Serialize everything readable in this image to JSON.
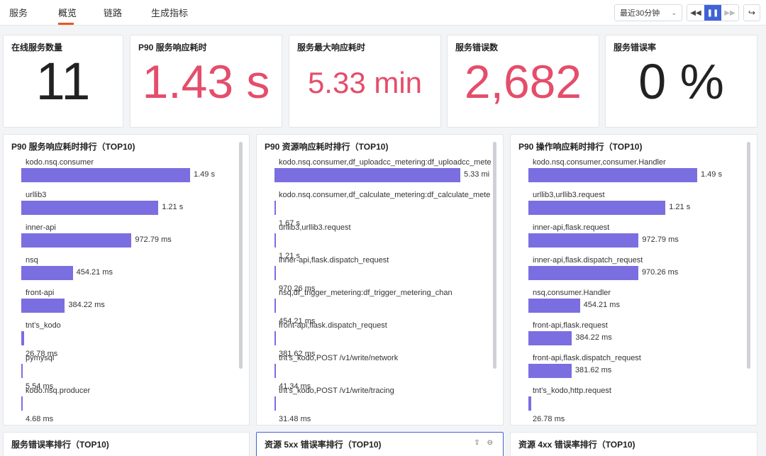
{
  "tabs": [
    "服务",
    "概览",
    "链路",
    "生成指标"
  ],
  "controls": {
    "time_range": "最近30分钟",
    "rewind": "◀◀",
    "pause": "❚❚",
    "forward": "▶▶",
    "share": "↪"
  },
  "stats": [
    {
      "title": "在线服务数量",
      "value": "11",
      "color": "#222222"
    },
    {
      "title": "P90 服务响应耗时",
      "value": "1.43 s",
      "color": "#e54d6b"
    },
    {
      "title": "服务最大响应耗时",
      "value": "5.33 min",
      "color": "#e54d6b"
    },
    {
      "title": "服务错误数",
      "value": "2,682",
      "color": "#e54d6b"
    },
    {
      "title": "服务错误率",
      "value": "0 %",
      "color": "#222222"
    }
  ],
  "panels": [
    {
      "title": "P90 服务响应耗时排行（TOP10)",
      "rows": [
        {
          "label": "kodo.nsq.consumer",
          "value": "1.49 s",
          "fraction": 1.0
        },
        {
          "label": "urllib3",
          "value": "1.21 s",
          "fraction": 0.812
        },
        {
          "label": "inner-api",
          "value": "972.79 ms",
          "fraction": 0.653
        },
        {
          "label": "nsq",
          "value": "454.21 ms",
          "fraction": 0.305
        },
        {
          "label": "front-api",
          "value": "384.22 ms",
          "fraction": 0.258
        },
        {
          "label": "tnt's_kodo",
          "value": "26.78 ms",
          "fraction": 0.018
        },
        {
          "label": "pymysql",
          "value": "5.54 ms",
          "fraction": 0.004
        },
        {
          "label": "kodo.nsq.producer",
          "value": "4.68 ms",
          "fraction": 0.003
        }
      ]
    },
    {
      "title": "P90 资源响应耗时排行（TOP10)",
      "rows": [
        {
          "label": "kodo.nsq.consumer,df_uploadcc_metering:df_uploadcc_mete",
          "value": "5.33 mi",
          "fraction": 1.0
        },
        {
          "label": "kodo.nsq.consumer,df_calculate_metering:df_calculate_mete",
          "value": "1.67 s",
          "fraction": 0.005
        },
        {
          "label": "urllib3,urllib3.request",
          "value": "1.21 s",
          "fraction": 0.004
        },
        {
          "label": "inner-api,flask.dispatch_request",
          "value": "970.26 ms",
          "fraction": 0.003
        },
        {
          "label": "nsq,df_trigger_metering:df_trigger_metering_chan",
          "value": "454.21 ms",
          "fraction": 0.0015
        },
        {
          "label": "front-api,flask.dispatch_request",
          "value": "381.62 ms",
          "fraction": 0.0012
        },
        {
          "label": "tnt's_kodo,POST /v1/write/network",
          "value": "41.34 ms",
          "fraction": 0.0001
        },
        {
          "label": "tnt's_kodo,POST /v1/write/tracing",
          "value": "31.48 ms",
          "fraction": 0.0001
        }
      ]
    },
    {
      "title": "P90 操作响应耗时排行（TOP10)",
      "rows": [
        {
          "label": "kodo.nsq.consumer,consumer.Handler",
          "value": "1.49 s",
          "fraction": 1.0
        },
        {
          "label": "urllib3,urllib3.request",
          "value": "1.21 s",
          "fraction": 0.812
        },
        {
          "label": "inner-api,flask.request",
          "value": "972.79 ms",
          "fraction": 0.653
        },
        {
          "label": "inner-api,flask.dispatch_request",
          "value": "970.26 ms",
          "fraction": 0.651
        },
        {
          "label": "nsq,consumer.Handler",
          "value": "454.21 ms",
          "fraction": 0.305
        },
        {
          "label": "front-api,flask.request",
          "value": "384.22 ms",
          "fraction": 0.258
        },
        {
          "label": "front-api,flask.dispatch_request",
          "value": "381.62 ms",
          "fraction": 0.256
        },
        {
          "label": "tnt's_kodo,http.request",
          "value": "26.78 ms",
          "fraction": 0.018
        }
      ]
    }
  ],
  "bottom_panels": [
    {
      "title": "服务错误率排行（TOP10)"
    },
    {
      "title": "资源 5xx 错误率排行（TOP10)"
    },
    {
      "title": "资源 4xx 错误率排行（TOP10)"
    }
  ],
  "bottom_icons": {
    "export": "⇪",
    "zoom": "⊖"
  }
}
